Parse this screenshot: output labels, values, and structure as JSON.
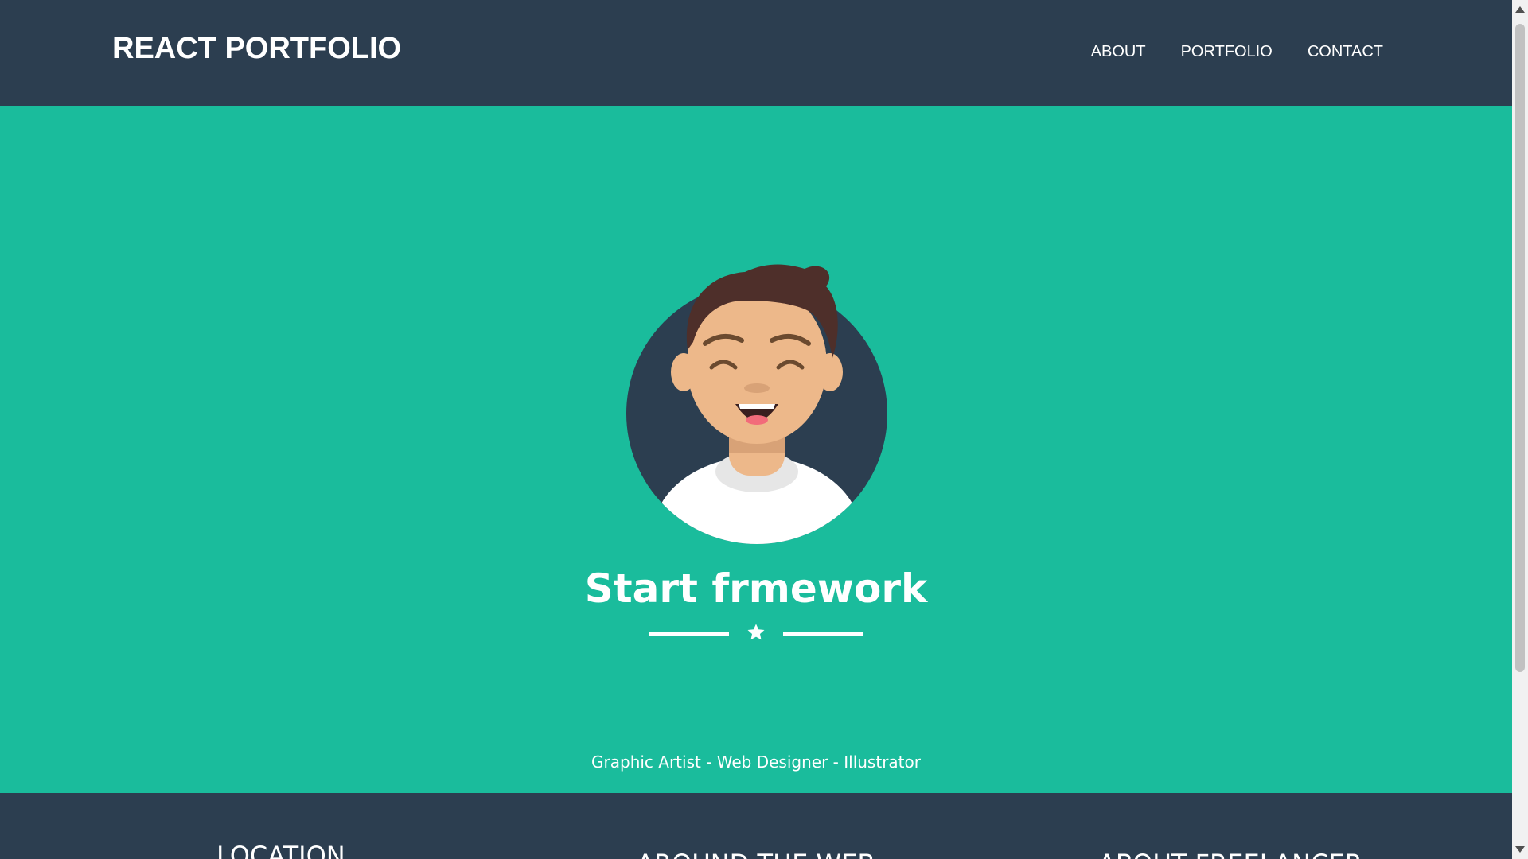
{
  "navbar": {
    "brand": "REACT PORTFOLIO",
    "links": [
      {
        "label": "ABOUT"
      },
      {
        "label": "PORTFOLIO"
      },
      {
        "label": "CONTACT"
      }
    ]
  },
  "hero": {
    "avatar_icon": "avatar-illustration",
    "title": "Start frmework",
    "divider_icon": "star-icon",
    "subtitle": "Graphic Artist - Web Designer - Illustrator"
  },
  "footer": {
    "col1_title": "LOCATION",
    "col2_title": "AROUND THE WEB",
    "col3_title": "ABOUT FREELANCER"
  },
  "colors": {
    "primary": "#2c3e50",
    "accent": "#1abc9c",
    "text": "#ffffff"
  }
}
